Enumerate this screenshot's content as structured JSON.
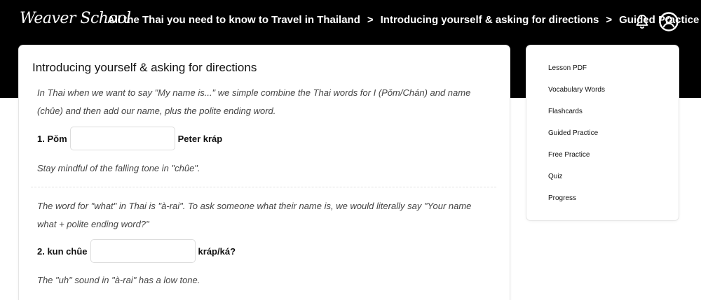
{
  "nav": {
    "logo": "Weaver School",
    "breadcrumbs": [
      "All the Thai you need to know to Travel in Thailand",
      "Introducing yourself & asking for directions",
      "Guided Practice"
    ],
    "separator": ">",
    "bell_icon": "bell-icon",
    "account_icon": "account-circle-icon"
  },
  "lesson": {
    "title": "Introducing yourself & asking for directions",
    "q1": {
      "intro_line1": "In Thai when we want to say \"My name is...\" we simple combine the Thai words for I (Pǒm/Chán) and name",
      "intro_line2": "(chûe) and then add our name, plus the polite ending word.",
      "prefix": "1. Pǒm",
      "input_value": "",
      "suffix": "Peter kráp",
      "hint": "Stay mindful of the falling tone in \"chûe\"."
    },
    "q2": {
      "intro_line1": "The word for \"what\" in Thai is \"à-rai\". To ask someone what their name is, we would literally say \"Your name",
      "intro_line2": "what + polite ending word?\"",
      "prefix": "2. kun chûe",
      "input_value": "",
      "suffix": "kráp/ká?",
      "hint": "The \"uh\" sound in \"à-rai\" has a low tone."
    }
  },
  "sidebar": {
    "items": [
      "Lesson PDF",
      "Vocabulary Words",
      "Flashcards",
      "Guided Practice",
      "Free Practice",
      "Quiz",
      "Progress"
    ]
  }
}
